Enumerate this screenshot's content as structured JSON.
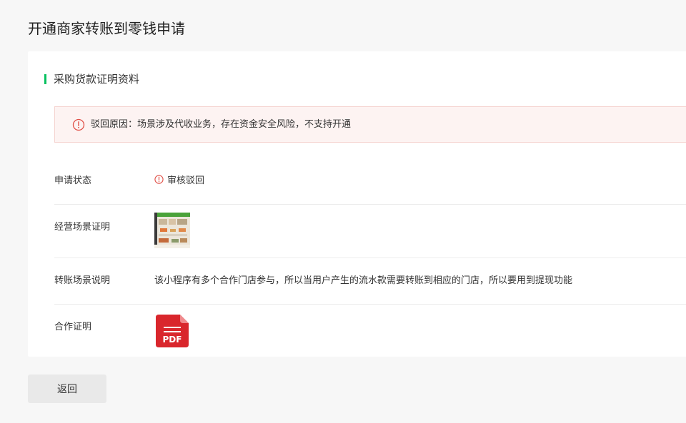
{
  "page": {
    "title": "开通商家转账到零钱申请"
  },
  "section": {
    "title": "采购货款证明资料",
    "accent_color": "#07c160"
  },
  "alert": {
    "icon": "exclamation-circle-icon",
    "text": "驳回原因：场景涉及代收业务，存在资金安全风险，不支持开通",
    "color": "#e04f46"
  },
  "rows": {
    "status": {
      "label": "申请状态",
      "value": "审核驳回",
      "icon": "exclamation-circle-icon"
    },
    "scene_proof": {
      "label": "经营场景证明",
      "image": "scene-proof-thumbnail"
    },
    "transfer_desc": {
      "label": "转账场景说明",
      "value": "该小程序有多个合作门店参与，所以当用户产生的流水款需要转账到相应的门店，所以要用到提现功能"
    },
    "coop_proof": {
      "label": "合作证明",
      "file_icon": "pdf-file-icon",
      "file_badge": "PDF"
    }
  },
  "footer": {
    "back_label": "返回"
  }
}
